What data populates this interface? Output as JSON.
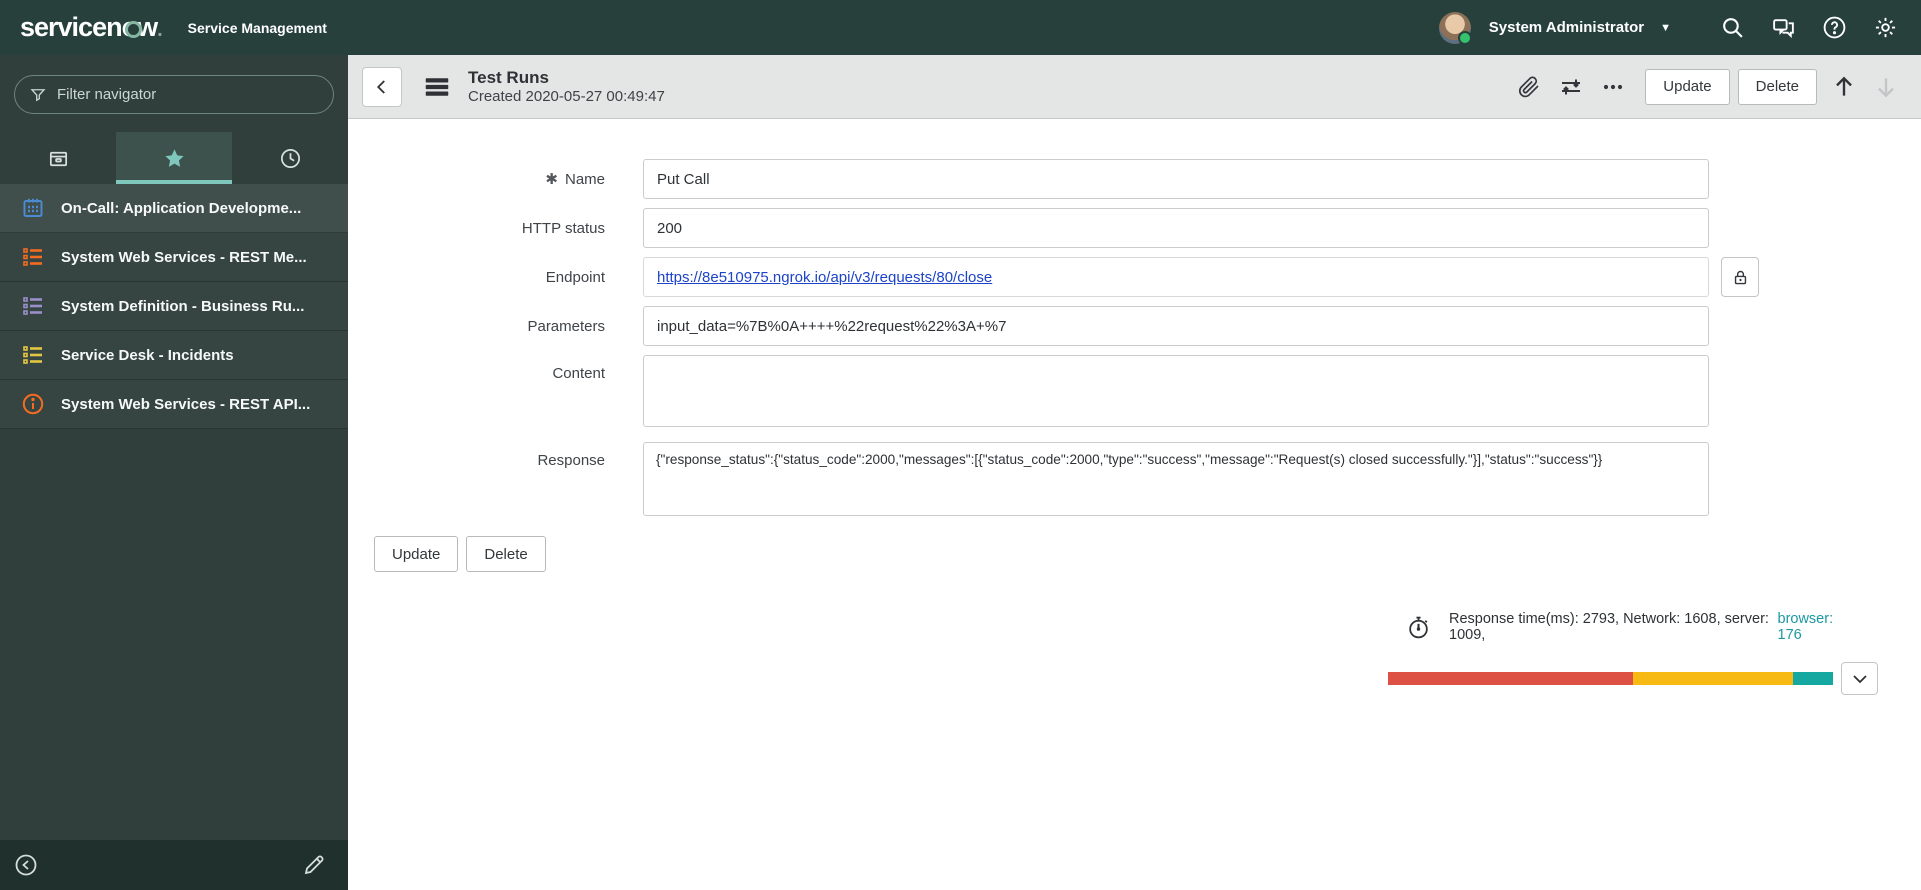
{
  "topbar": {
    "brand_left": "servicen",
    "brand_o": "o",
    "brand_right": "w",
    "brand_dot": ".",
    "product": "Service Management",
    "user_name": "System Administrator",
    "icons": [
      "search-icon",
      "chat-icon",
      "help-icon",
      "gear-icon"
    ]
  },
  "sidebar": {
    "filter_placeholder": "Filter navigator",
    "tabs": [
      {
        "name": "all-applications",
        "icon": "box-icon",
        "active": false
      },
      {
        "name": "favorites",
        "icon": "star-icon",
        "active": true
      },
      {
        "name": "history",
        "icon": "clock-icon",
        "active": false
      }
    ],
    "items": [
      {
        "label": "On-Call: Application Developme...",
        "icon": "calendar-icon",
        "color": "#4a8bd4"
      },
      {
        "label": "System Web Services - REST Me...",
        "icon": "list-icon",
        "color": "#f36c21"
      },
      {
        "label": "System Definition - Business Ru...",
        "icon": "list-icon",
        "color": "#9a8fca"
      },
      {
        "label": "Service Desk - Incidents",
        "icon": "list-icon",
        "color": "#e3c742"
      },
      {
        "label": "System Web Services - REST API...",
        "icon": "info-icon",
        "color": "#f36c21"
      }
    ]
  },
  "record_header": {
    "title": "Test Runs",
    "subtitle": "Created 2020-05-27 00:49:47",
    "icons": [
      "attachment-icon",
      "personalize-icon",
      "more-icon",
      "arrow-up-icon",
      "arrow-down-icon"
    ],
    "update_label": "Update",
    "delete_label": "Delete"
  },
  "form": {
    "name": {
      "label": "Name",
      "required": true,
      "value": "Put Call"
    },
    "http_status": {
      "label": "HTTP status",
      "value": "200"
    },
    "endpoint": {
      "label": "Endpoint",
      "value": "https://8e510975.ngrok.io/api/v3/requests/80/close"
    },
    "parameters": {
      "label": "Parameters",
      "value": "input_data=%7B%0A++++%22request%22%3A+%7"
    },
    "content": {
      "label": "Content",
      "value": ""
    },
    "response": {
      "label": "Response",
      "value": "{\"response_status\":{\"status_code\":2000,\"messages\":[{\"status_code\":2000,\"type\":\"success\",\"message\":\"Request(s) closed successfully.\"}],\"status\":\"success\"}}"
    },
    "update_label": "Update",
    "delete_label": "Delete"
  },
  "performance": {
    "summary_prefix": "Response time(ms): 2793, Network: 1608, server: 1009,",
    "browser_text": "browser: 176",
    "response_time_ms": 2793,
    "network_ms": 1608,
    "server_ms": 1009,
    "browser_ms": 176,
    "segments": [
      {
        "name": "network",
        "color": "#dd5145",
        "pct": 55
      },
      {
        "name": "server",
        "color": "#f7ba15",
        "pct": 36
      },
      {
        "name": "browser",
        "color": "#14a8a0",
        "pct": 9
      }
    ]
  }
}
